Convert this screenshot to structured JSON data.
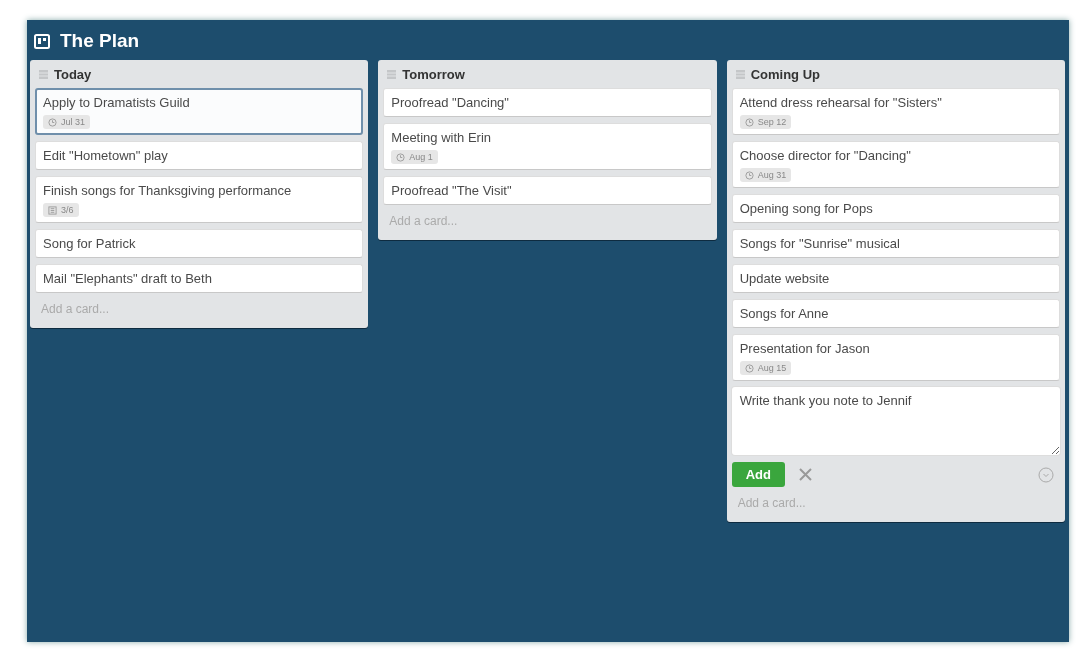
{
  "board": {
    "title": "The Plan"
  },
  "lists": [
    {
      "name": "Today",
      "cards": [
        {
          "title": "Apply to Dramatists Guild",
          "selected": true,
          "badges": [
            {
              "kind": "due",
              "text": "Jul 31"
            }
          ]
        },
        {
          "title": "Edit \"Hometown\" play",
          "selected": false
        },
        {
          "title": "Finish songs for Thanksgiving performance",
          "selected": false,
          "badges": [
            {
              "kind": "checklist",
              "text": "3/6"
            }
          ]
        },
        {
          "title": "Song for Patrick",
          "selected": false
        },
        {
          "title": "Mail \"Elephants\" draft to Beth",
          "selected": false
        }
      ],
      "add_card": "Add a card..."
    },
    {
      "name": "Tomorrow",
      "cards": [
        {
          "title": "Proofread \"Dancing\"",
          "selected": false
        },
        {
          "title": "Meeting with Erin",
          "selected": false,
          "badges": [
            {
              "kind": "due",
              "text": "Aug 1"
            }
          ]
        },
        {
          "title": "Proofread \"The Visit\"",
          "selected": false
        }
      ],
      "add_card": "Add a card..."
    },
    {
      "name": "Coming Up",
      "cards": [
        {
          "title": "Attend dress rehearsal for \"Sisters\"",
          "selected": false,
          "badges": [
            {
              "kind": "due",
              "text": "Sep 12"
            }
          ]
        },
        {
          "title": "Choose director for \"Dancing\"",
          "selected": false,
          "badges": [
            {
              "kind": "due",
              "text": "Aug 31"
            }
          ]
        },
        {
          "title": "Opening song for Pops",
          "selected": false
        },
        {
          "title": "Songs for \"Sunrise\" musical",
          "selected": false
        },
        {
          "title": "Update website",
          "selected": false
        },
        {
          "title": "Songs for Anne",
          "selected": false
        },
        {
          "title": "Presentation for Jason",
          "selected": false,
          "badges": [
            {
              "kind": "due",
              "text": "Aug 15"
            }
          ]
        }
      ],
      "composer": {
        "value": "Write thank you note to Jennif",
        "add_button": "Add"
      },
      "add_card": "Add a card..."
    }
  ]
}
